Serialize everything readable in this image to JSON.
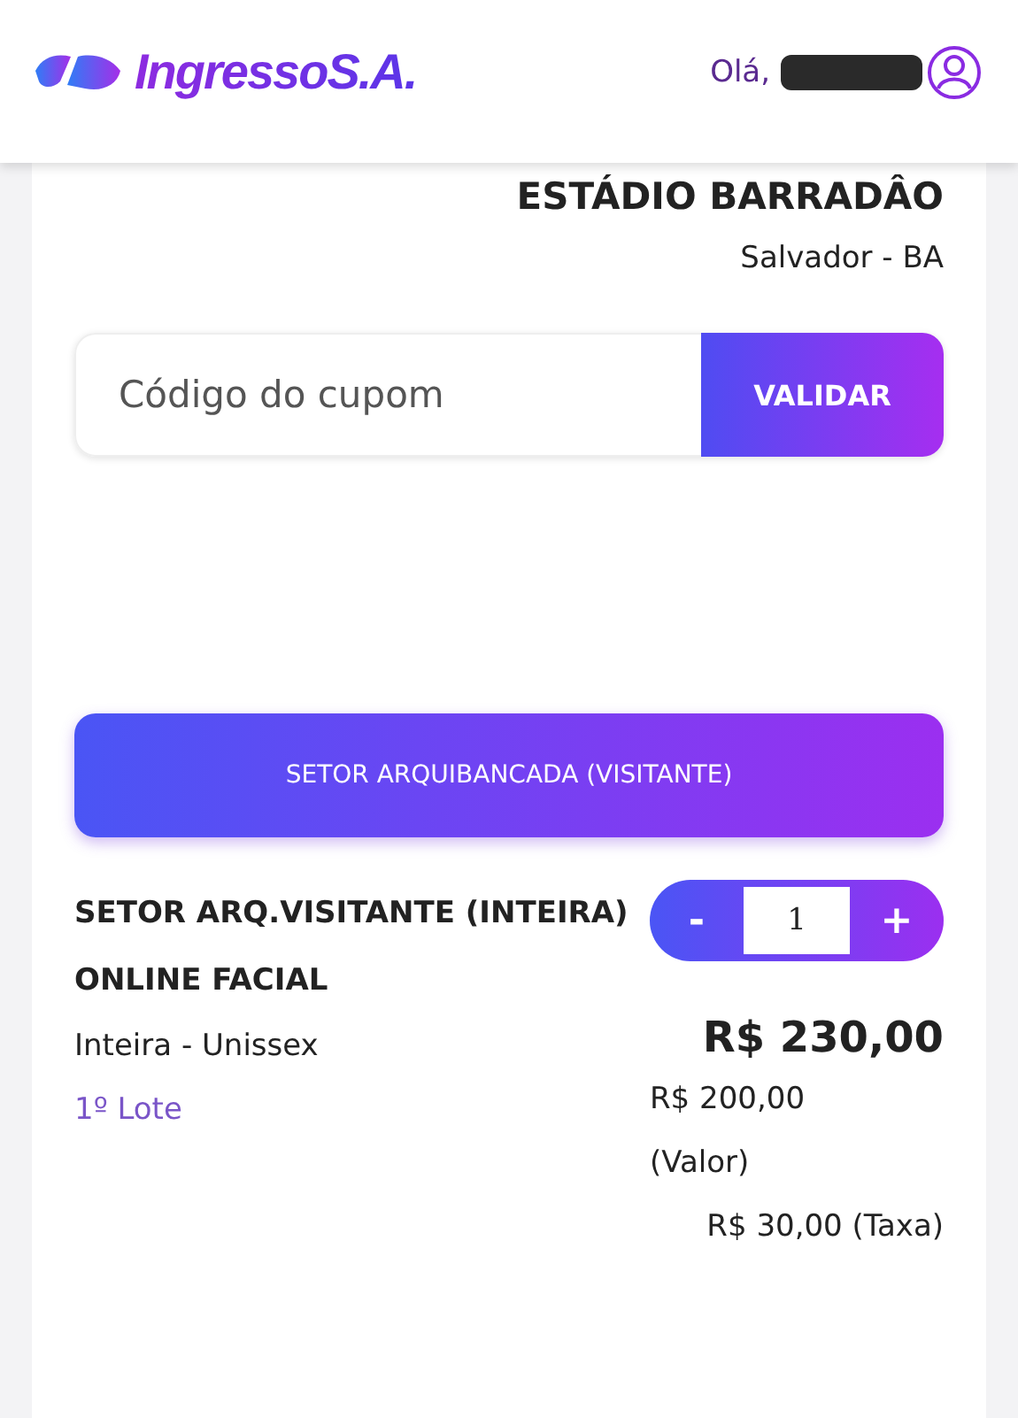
{
  "header": {
    "brand": "IngressoS.A.",
    "greeting": "Olá,"
  },
  "venue": {
    "name": "ESTÁDIO BARRADÂO",
    "city": "Salvador - BA"
  },
  "coupon": {
    "placeholder": "Código do cupom",
    "button": "VALIDAR"
  },
  "sector": {
    "label": "SETOR ARQUIBANCADA (VISITANTE)"
  },
  "ticket": {
    "title": "SETOR ARQ.VISITANTE (INTEIRA)",
    "subtitle": "ONLINE FACIAL",
    "type": "Inteira - Unissex",
    "batch": "1º Lote",
    "minus": "-",
    "quantity": "1",
    "plus": "+",
    "total": "R$ 230,00",
    "value": "R$ 200,00",
    "value_label": "(Valor)",
    "fee": "R$ 30,00 (Taxa)"
  }
}
